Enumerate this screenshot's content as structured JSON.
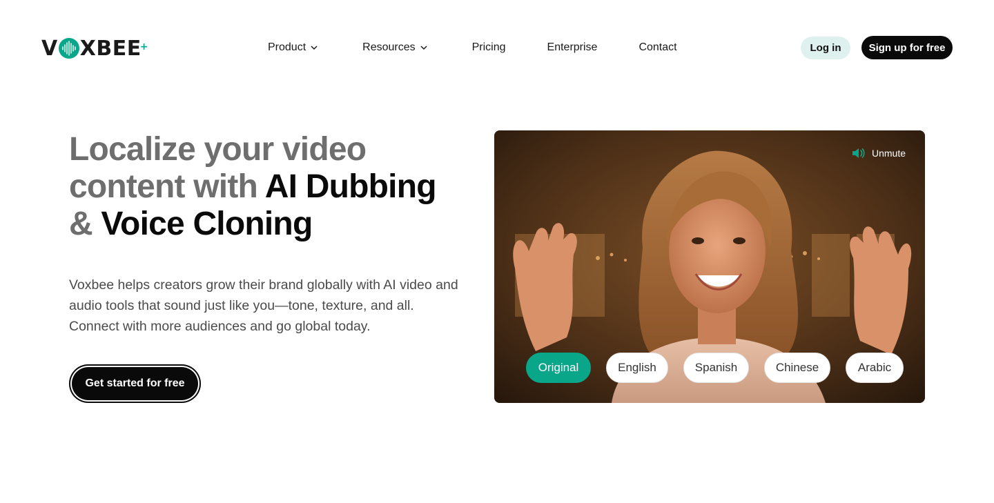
{
  "brand": {
    "name": "VOXBEE",
    "accent_color": "#0aa68a"
  },
  "nav": {
    "items": [
      {
        "label": "Product",
        "has_dropdown": true,
        "icon": "chevron-down-icon"
      },
      {
        "label": "Resources",
        "has_dropdown": true,
        "icon": "chevron-down-icon"
      },
      {
        "label": "Pricing",
        "has_dropdown": false
      },
      {
        "label": "Enterprise",
        "has_dropdown": false
      },
      {
        "label": "Contact",
        "has_dropdown": false
      }
    ]
  },
  "auth": {
    "login_label": "Log in",
    "signup_label": "Sign up for free"
  },
  "hero": {
    "title_part1": "Localize your video content with ",
    "title_part2": "AI Dubbing",
    "title_part3": "& ",
    "title_part4": "Voice Cloning",
    "description": "Voxbee helps creators grow their brand globally with AI video and audio tools that sound just like you—tone, texture, and all. Connect with more audiences and go global today.",
    "cta_label": "Get started for free"
  },
  "video": {
    "unmute_label": "Unmute",
    "unmute_icon": "speaker-icon",
    "languages": [
      {
        "label": "Original",
        "active": true
      },
      {
        "label": "English",
        "active": false
      },
      {
        "label": "Spanish",
        "active": false
      },
      {
        "label": "Chinese",
        "active": false
      },
      {
        "label": "Arabic",
        "active": false
      }
    ]
  }
}
